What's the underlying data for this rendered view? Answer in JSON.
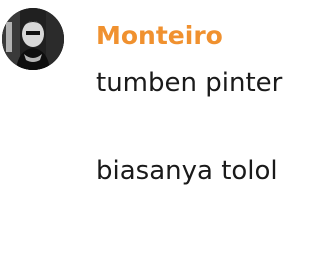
{
  "message": {
    "sender": "Monteiro",
    "lines": [
      "tumben pinter",
      "",
      "biasanya tolol"
    ],
    "sender_color": "#f0912f",
    "avatar_icon": "user-avatar-photo"
  }
}
